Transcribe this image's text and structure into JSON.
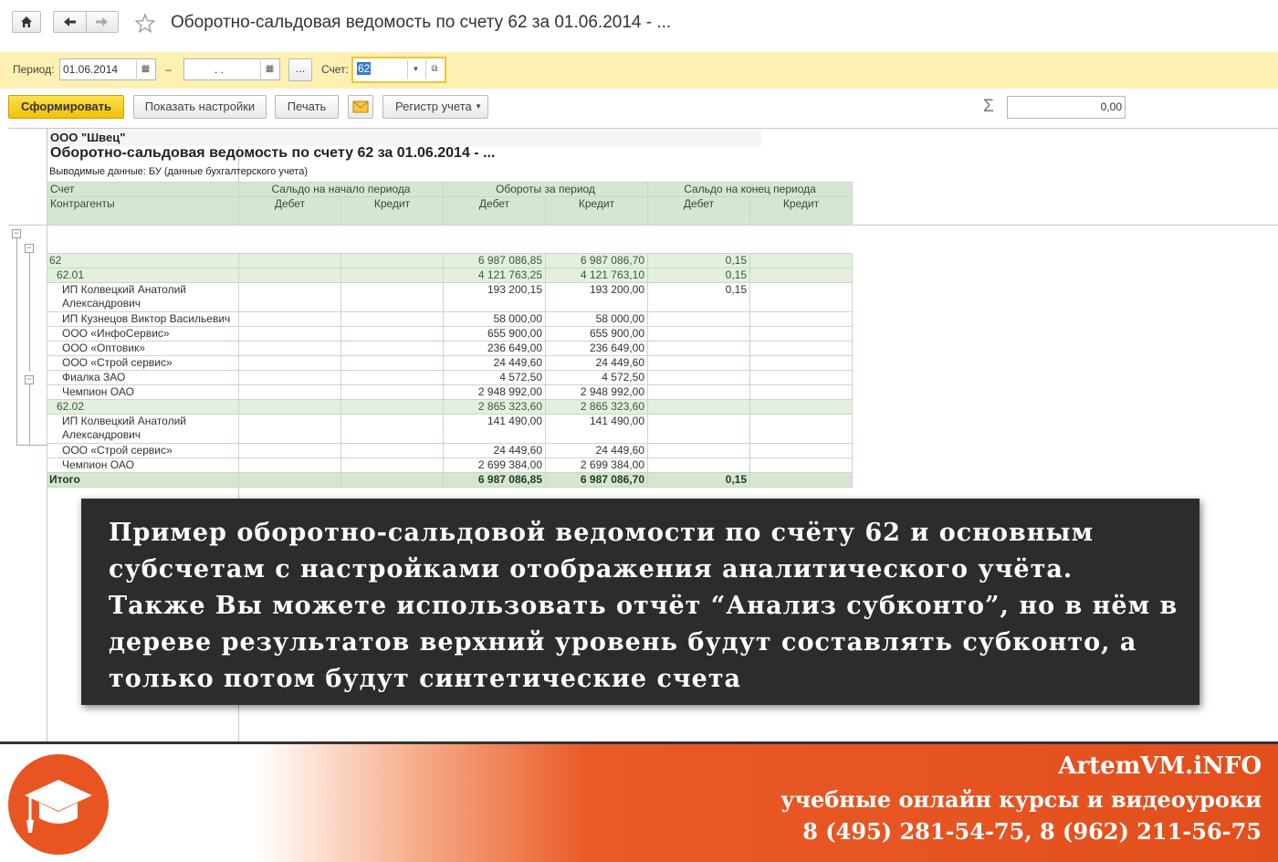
{
  "window": {
    "title": "Оборотно-сальдовая ведомость по счету 62 за 01.06.2014 - ...",
    "icons": {
      "home": "home-icon",
      "back": "arrow-left-icon",
      "forward": "arrow-right-icon",
      "favorite": "star-icon"
    }
  },
  "filters": {
    "period_label": "Период:",
    "period_from": "01.06.2014",
    "dash": "–",
    "period_to": ". .",
    "ellipsis": "...",
    "account_label": "Счет:",
    "account_value": "62"
  },
  "toolbar": {
    "generate": "Сформировать",
    "show_settings": "Показать настройки",
    "print": "Печать",
    "register": "Регистр учета",
    "sum_symbol": "Σ",
    "sum_value": "0,00"
  },
  "report": {
    "company": "ООО \"Швец\"",
    "title": "Оборотно-сальдовая ведомость по счету 62 за 01.06.2014 - ...",
    "data_note": "Выводимые данные:  БУ (данные бухгалтерского учета)",
    "headers": {
      "account": "Счет",
      "counterparties": "Контрагенты",
      "opening": "Сальдо на начало периода",
      "turnover": "Обороты за период",
      "closing": "Сальдо на конец периода",
      "debit": "Дебет",
      "credit": "Кредит"
    },
    "rows": [
      {
        "kind": "grp",
        "label": "62",
        "indent": 0,
        "v": [
          "",
          "",
          "6 987 086,85",
          "6 987 086,70",
          "0,15",
          ""
        ]
      },
      {
        "kind": "grp",
        "label": "62.01",
        "indent": 1,
        "v": [
          "",
          "",
          "4 121 763,25",
          "4 121 763,10",
          "0,15",
          ""
        ]
      },
      {
        "kind": "tall",
        "label": "ИП Колвецкий Анатолий",
        "label2": "Александрович",
        "indent": 2,
        "v": [
          "",
          "",
          "193 200,15",
          "193 200,00",
          "0,15",
          ""
        ]
      },
      {
        "kind": "row",
        "label": "ИП Кузнецов Виктор Васильевич",
        "indent": 2,
        "v": [
          "",
          "",
          "58 000,00",
          "58 000,00",
          "",
          ""
        ]
      },
      {
        "kind": "row",
        "label": "ООО «ИнфоСервис»",
        "indent": 2,
        "v": [
          "",
          "",
          "655 900,00",
          "655 900,00",
          "",
          ""
        ]
      },
      {
        "kind": "row",
        "label": "ООО «Оптовик»",
        "indent": 2,
        "v": [
          "",
          "",
          "236 649,00",
          "236 649,00",
          "",
          ""
        ]
      },
      {
        "kind": "row",
        "label": "ООО «Строй сервис»",
        "indent": 2,
        "v": [
          "",
          "",
          "24 449,60",
          "24 449,60",
          "",
          ""
        ]
      },
      {
        "kind": "row",
        "label": "Фиалка ЗАО",
        "indent": 2,
        "v": [
          "",
          "",
          "4 572,50",
          "4 572,50",
          "",
          ""
        ]
      },
      {
        "kind": "row",
        "label": "Чемпион ОАО",
        "indent": 2,
        "v": [
          "",
          "",
          "2 948 992,00",
          "2 948 992,00",
          "",
          ""
        ]
      },
      {
        "kind": "grp",
        "label": "62.02",
        "indent": 1,
        "v": [
          "",
          "",
          "2 865 323,60",
          "2 865 323,60",
          "",
          ""
        ]
      },
      {
        "kind": "tall",
        "label": "ИП Колвецкий Анатолий",
        "label2": "Александрович",
        "indent": 2,
        "v": [
          "",
          "",
          "141 490,00",
          "141 490,00",
          "",
          ""
        ]
      },
      {
        "kind": "row",
        "label": "ООО «Строй сервис»",
        "indent": 2,
        "v": [
          "",
          "",
          "24 449,60",
          "24 449,60",
          "",
          ""
        ]
      },
      {
        "kind": "row",
        "label": "Чемпион ОАО",
        "indent": 2,
        "v": [
          "",
          "",
          "2 699 384,00",
          "2 699 384,00",
          "",
          ""
        ]
      },
      {
        "kind": "tot",
        "label": "Итого",
        "indent": 0,
        "v": [
          "",
          "",
          "6 987 086,85",
          "6 987 086,70",
          "0,15",
          ""
        ]
      }
    ]
  },
  "overlay": {
    "lines": [
      "Пример оборотно-сальдовой ведомости по счёту 62 и основным",
      "субсчетам с настройками отображения аналитического учёта.",
      "Также Вы можете использовать отчёт “Анализ субконто”, но в нём в",
      "дереве результатов верхний уровень будут составлять субконто, а",
      "только потом будут синтетические счета"
    ]
  },
  "footer": {
    "site": "ArtemVM.iNFO",
    "tagline": "учебные онлайн курсы и видеоуроки",
    "phones": "8 (495) 281-54-75, 8 (962) 211-56-75",
    "logo_icon": "graduation-cap-icon",
    "accent": "#e95522"
  }
}
